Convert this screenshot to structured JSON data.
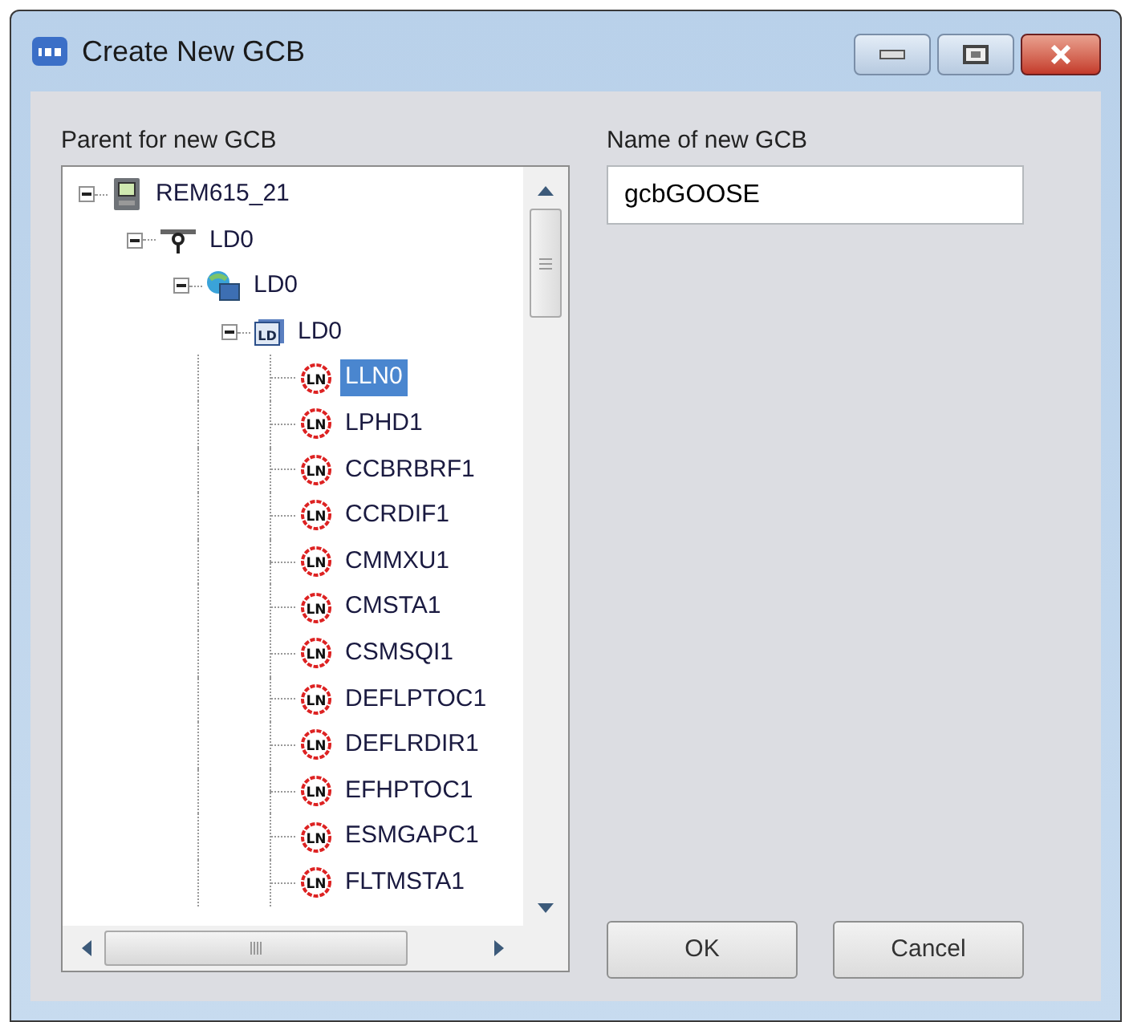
{
  "window": {
    "title": "Create New GCB"
  },
  "parent_label": "Parent for new GCB",
  "tree": [
    {
      "label": "REM615_21",
      "kind": "ied",
      "expanded": true,
      "selected": false,
      "children": [
        {
          "label": "LD0",
          "kind": "access_point",
          "expanded": true,
          "selected": false,
          "children": [
            {
              "label": "LD0",
              "kind": "server",
              "expanded": true,
              "selected": false,
              "children": [
                {
                  "label": "LD0",
                  "kind": "ld",
                  "icon_text": "LD",
                  "expanded": true,
                  "selected": false,
                  "children": [
                    {
                      "label": "LLN0",
                      "kind": "ln",
                      "icon_text": "LN",
                      "selected": true
                    },
                    {
                      "label": "LPHD1",
                      "kind": "ln",
                      "icon_text": "LN",
                      "selected": false
                    },
                    {
                      "label": "CCBRBRF1",
                      "kind": "ln",
                      "icon_text": "LN",
                      "selected": false
                    },
                    {
                      "label": "CCRDIF1",
                      "kind": "ln",
                      "icon_text": "LN",
                      "selected": false
                    },
                    {
                      "label": "CMMXU1",
                      "kind": "ln",
                      "icon_text": "LN",
                      "selected": false
                    },
                    {
                      "label": "CMSTA1",
                      "kind": "ln",
                      "icon_text": "LN",
                      "selected": false
                    },
                    {
                      "label": "CSMSQI1",
                      "kind": "ln",
                      "icon_text": "LN",
                      "selected": false
                    },
                    {
                      "label": "DEFLPTOC1",
                      "kind": "ln",
                      "icon_text": "LN",
                      "selected": false
                    },
                    {
                      "label": "DEFLRDIR1",
                      "kind": "ln",
                      "icon_text": "LN",
                      "selected": false
                    },
                    {
                      "label": "EFHPTOC1",
                      "kind": "ln",
                      "icon_text": "LN",
                      "selected": false
                    },
                    {
                      "label": "ESMGAPC1",
                      "kind": "ln",
                      "icon_text": "LN",
                      "selected": false
                    },
                    {
                      "label": "FLTMSTA1",
                      "kind": "ln",
                      "icon_text": "LN",
                      "selected": false
                    }
                  ]
                }
              ]
            }
          ]
        }
      ]
    }
  ],
  "name_label": "Name of new GCB",
  "name_field": {
    "value": "gcbGOOSE"
  },
  "buttons": [
    {
      "label": "OK"
    },
    {
      "label": "Cancel"
    }
  ]
}
